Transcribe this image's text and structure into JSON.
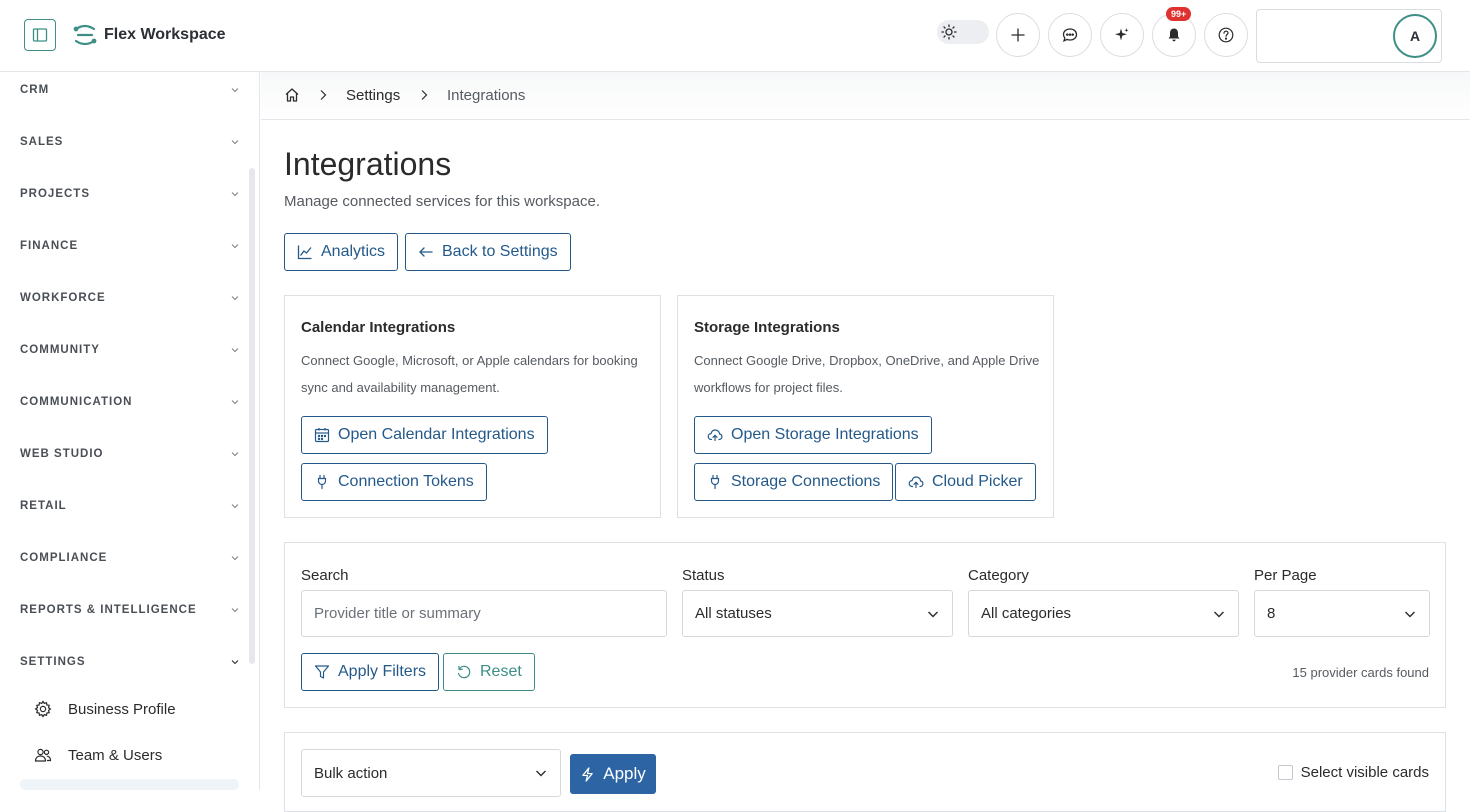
{
  "header": {
    "app_title": "Flex Workspace",
    "notification_badge": "99+",
    "avatar_initial": "A",
    "icons": [
      "panel-toggle-icon",
      "logo-icon",
      "sun-icon",
      "plus-icon",
      "chat-icon",
      "sparkle-icon",
      "bell-icon",
      "help-icon"
    ]
  },
  "sidebar": {
    "sections": [
      {
        "label": "CRM"
      },
      {
        "label": "SALES"
      },
      {
        "label": "PROJECTS"
      },
      {
        "label": "FINANCE"
      },
      {
        "label": "WORKFORCE"
      },
      {
        "label": "COMMUNITY"
      },
      {
        "label": "COMMUNICATION"
      },
      {
        "label": "WEB STUDIO"
      },
      {
        "label": "RETAIL"
      },
      {
        "label": "COMPLIANCE"
      },
      {
        "label": "REPORTS & INTELLIGENCE"
      },
      {
        "label": "SETTINGS",
        "expanded": true
      }
    ],
    "settings_items": [
      {
        "label": "Business Profile",
        "icon": "gear-icon"
      },
      {
        "label": "Team & Users",
        "icon": "users-icon"
      }
    ]
  },
  "breadcrumb": {
    "items": [
      "Settings",
      "Integrations"
    ],
    "icon": "home-icon"
  },
  "page": {
    "title": "Integrations",
    "subtitle": "Manage connected services for this workspace.",
    "analytics_label": "Analytics",
    "back_label": "Back to Settings"
  },
  "cards": {
    "calendar": {
      "title": "Calendar Integrations",
      "description": "Connect Google, Microsoft, or Apple calendars for booking sync and availability management.",
      "open_label": "Open Calendar Integrations",
      "tokens_label": "Connection Tokens"
    },
    "storage": {
      "title": "Storage Integrations",
      "description": "Connect Google Drive, Dropbox, OneDrive, and Apple Drive workflows for project files.",
      "open_label": "Open Storage Integrations",
      "connections_label": "Storage Connections",
      "picker_label": "Cloud Picker"
    }
  },
  "filters": {
    "search_label": "Search",
    "search_placeholder": "Provider title or summary",
    "status_label": "Status",
    "status_value": "All statuses",
    "category_label": "Category",
    "category_value": "All categories",
    "per_page_label": "Per Page",
    "per_page_value": "8",
    "apply_label": "Apply Filters",
    "reset_label": "Reset",
    "found_text": "15 provider cards found"
  },
  "bulk": {
    "action_value": "Bulk action",
    "apply_label": "Apply",
    "select_visible_label": "Select visible cards"
  },
  "colors": {
    "accent_teal": "#3d8f86",
    "primary_blue": "#2c64a4",
    "outline_blue": "#24598a",
    "badge_red": "#e03131"
  }
}
